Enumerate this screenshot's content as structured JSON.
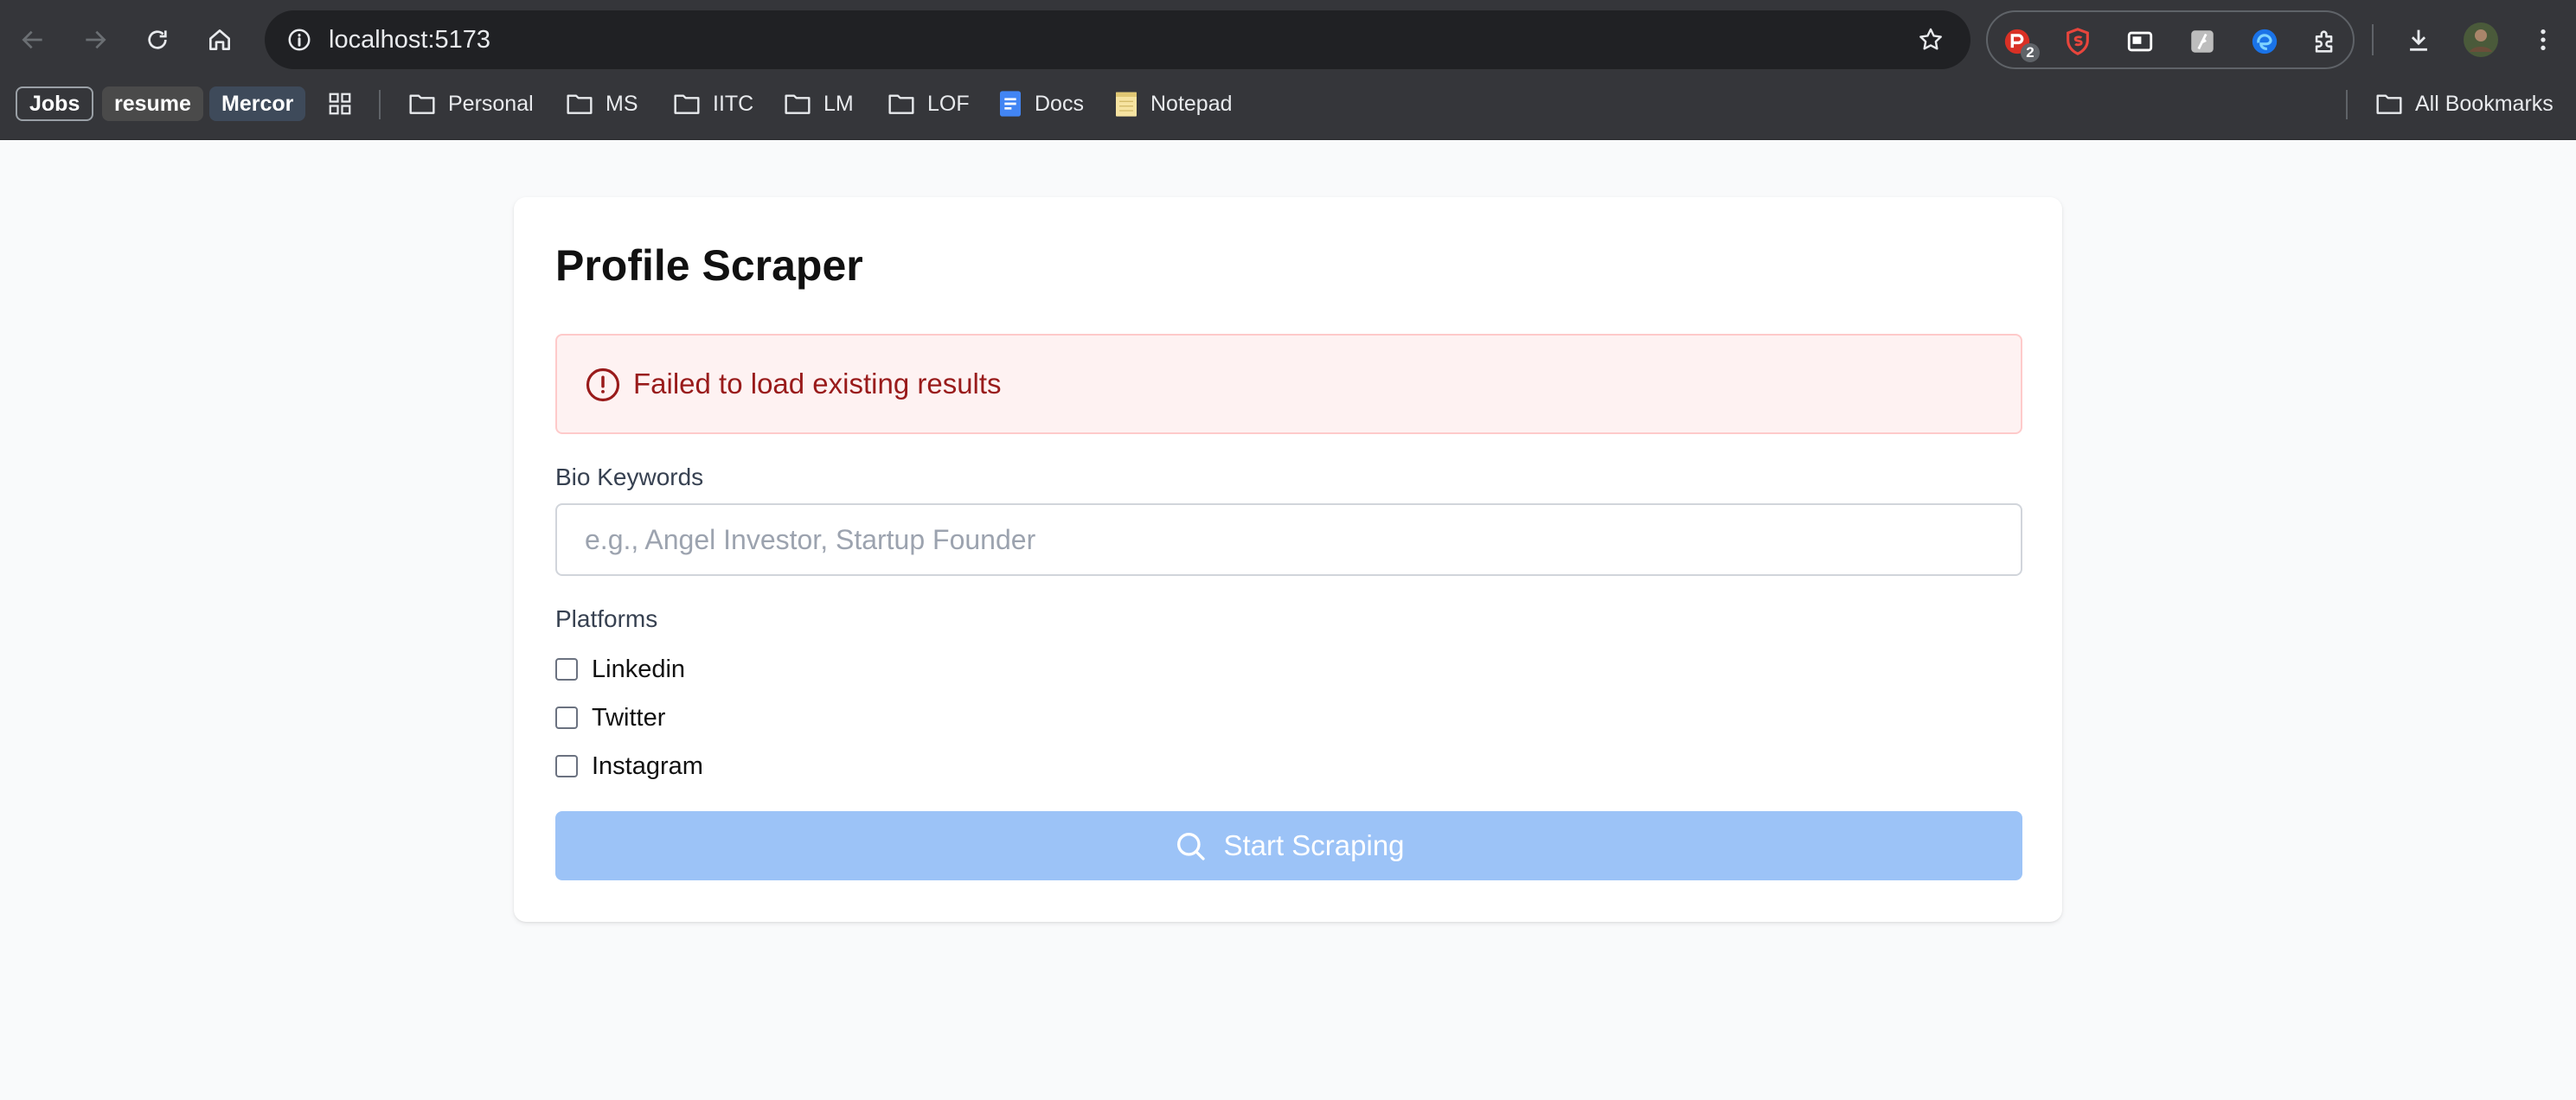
{
  "browser": {
    "url": "localhost:5173",
    "extension_badge_count": "2"
  },
  "bookmarks": {
    "chips": [
      "Jobs",
      "resume",
      "Mercor"
    ],
    "folders": [
      "Personal",
      "MS",
      "IITC",
      "LM",
      "LOF"
    ],
    "docs_label": "Docs",
    "notepad_label": "Notepad",
    "all_bookmarks_label": "All Bookmarks"
  },
  "page": {
    "title": "Profile Scraper",
    "error_message": "Failed to load existing results",
    "bio_keywords_label": "Bio Keywords",
    "bio_keywords_placeholder": "e.g., Angel Investor, Startup Founder",
    "bio_keywords_value": "",
    "platforms_label": "Platforms",
    "platforms": [
      {
        "label": "Linkedin",
        "checked": false
      },
      {
        "label": "Twitter",
        "checked": false
      },
      {
        "label": "Instagram",
        "checked": false
      }
    ],
    "start_button_label": "Start Scraping"
  },
  "colors": {
    "toolbar_bg": "#35363a",
    "omnibox_bg": "#202124",
    "page_bg": "#f9fafb",
    "alert_bg": "#fef2f2",
    "alert_border": "#fecaca",
    "alert_text": "#991b1b",
    "button_disabled_bg": "#9cc3f7"
  },
  "icons": {
    "back": "arrow-left-icon",
    "forward": "arrow-right-icon",
    "reload": "reload-icon",
    "home": "home-icon",
    "site_info": "info-icon",
    "bookmark_star": "star-icon",
    "downloads": "download-icon",
    "menu": "kebab-menu-icon",
    "alert": "alert-circle-icon",
    "search": "search-icon"
  }
}
